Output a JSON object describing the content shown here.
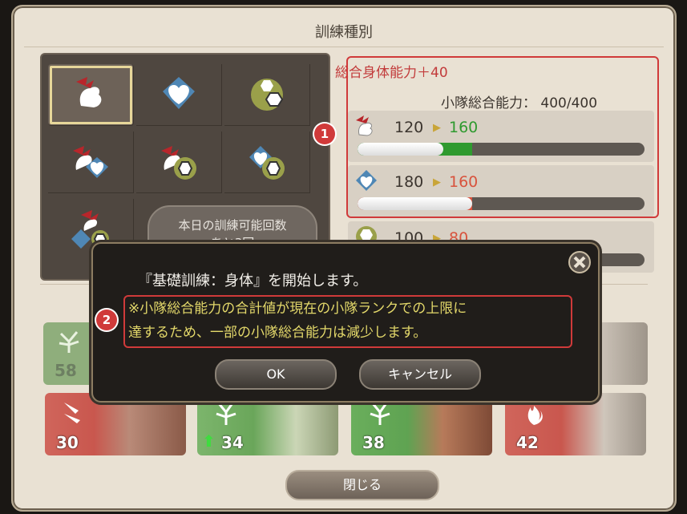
{
  "window": {
    "title": "訓練種別"
  },
  "training_grid": {
    "cells": [
      {
        "icon": "physical-training-icon",
        "selected": true
      },
      {
        "icon": "mental-training-icon",
        "selected": false
      },
      {
        "icon": "tactical-training-icon",
        "selected": false
      },
      {
        "icon": "physical-mental-training-icon",
        "selected": false
      },
      {
        "icon": "physical-tactical-training-icon",
        "selected": false
      },
      {
        "icon": "mental-tactical-training-icon",
        "selected": false
      },
      {
        "icon": "balanced-training-icon",
        "selected": false
      }
    ],
    "remaining_line1": "本日の訓練可能回数",
    "remaining_line2": "あと3回"
  },
  "stats_panel": {
    "gain_text": "総合身体能力＋40",
    "cap_text": "小隊総合能力： 400/400",
    "rows": [
      {
        "icon": "physical-icon",
        "current": "120",
        "next": "160",
        "next_color": "#2f9a2f",
        "current_fraction": 0.3,
        "next_fraction": 0.4
      },
      {
        "icon": "mental-icon",
        "current": "180",
        "next": "160",
        "next_color": "#d8533d",
        "current_fraction": 0.45,
        "next_fraction": 0.4
      },
      {
        "icon": "tactical-icon",
        "current": "100",
        "next": "80",
        "next_color": "#d8533d",
        "current_fraction": 0.25,
        "next_fraction": 0.2
      }
    ]
  },
  "annotations": {
    "badge1": "1",
    "badge2": "2"
  },
  "members": [
    {
      "level": "30",
      "color": "#c9574e",
      "icon": "dagger-icon"
    },
    {
      "level": "34",
      "color": "#6aa65a",
      "icon": "tree-icon"
    },
    {
      "level": "38",
      "color": "#5fa352",
      "icon": "tree-icon"
    },
    {
      "level": "42",
      "color": "#c9574e",
      "icon": "flame-icon"
    }
  ],
  "upper_members": [
    {
      "level": "58"
    }
  ],
  "dialog": {
    "message": "『基礎訓練：身体』を開始します。",
    "warning_line1": "※小隊総合能力の合計値が現在の小隊ランクでの上限に",
    "warning_line2": "達するため、一部の小隊総合能力は減少します。",
    "ok_label": "OK",
    "cancel_label": "キャンセル"
  },
  "close_button": {
    "label": "閉じる"
  },
  "colors": {
    "accent_red": "#d03a3a",
    "green": "#2f9a2f",
    "orange": "#d8533d"
  }
}
